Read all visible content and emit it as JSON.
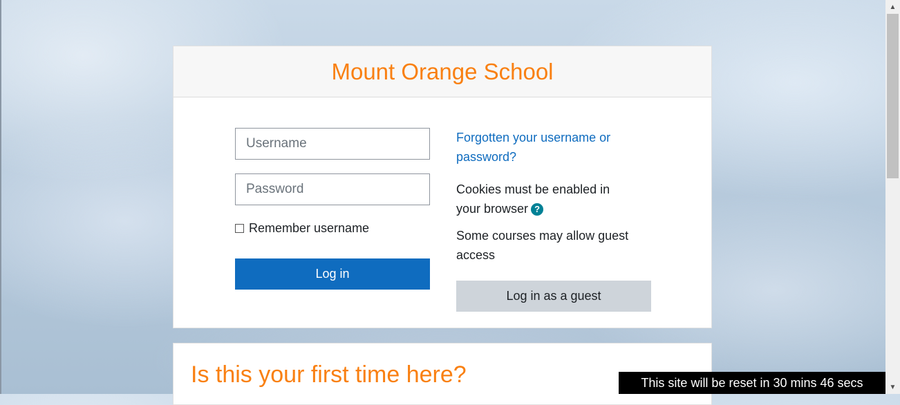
{
  "site": {
    "title": "Mount Orange School"
  },
  "login": {
    "username_placeholder": "Username",
    "password_placeholder": "Password",
    "remember_label": "Remember username",
    "login_button": "Log in",
    "forgot_link": "Forgotten your username or password?",
    "cookies_text": "Cookies must be enabled in your browser",
    "help_icon": "question-circle-icon",
    "guest_text": "Some courses may allow guest access",
    "guest_button": "Log in as a guest"
  },
  "first_time": {
    "heading": "Is this your first time here?"
  },
  "banner": {
    "text": "This site will be reset in 30 mins 46 secs"
  },
  "colors": {
    "brand": "#f98012",
    "primary": "#0f6cbf",
    "help": "#008196",
    "secondary_button": "#ced4da"
  }
}
